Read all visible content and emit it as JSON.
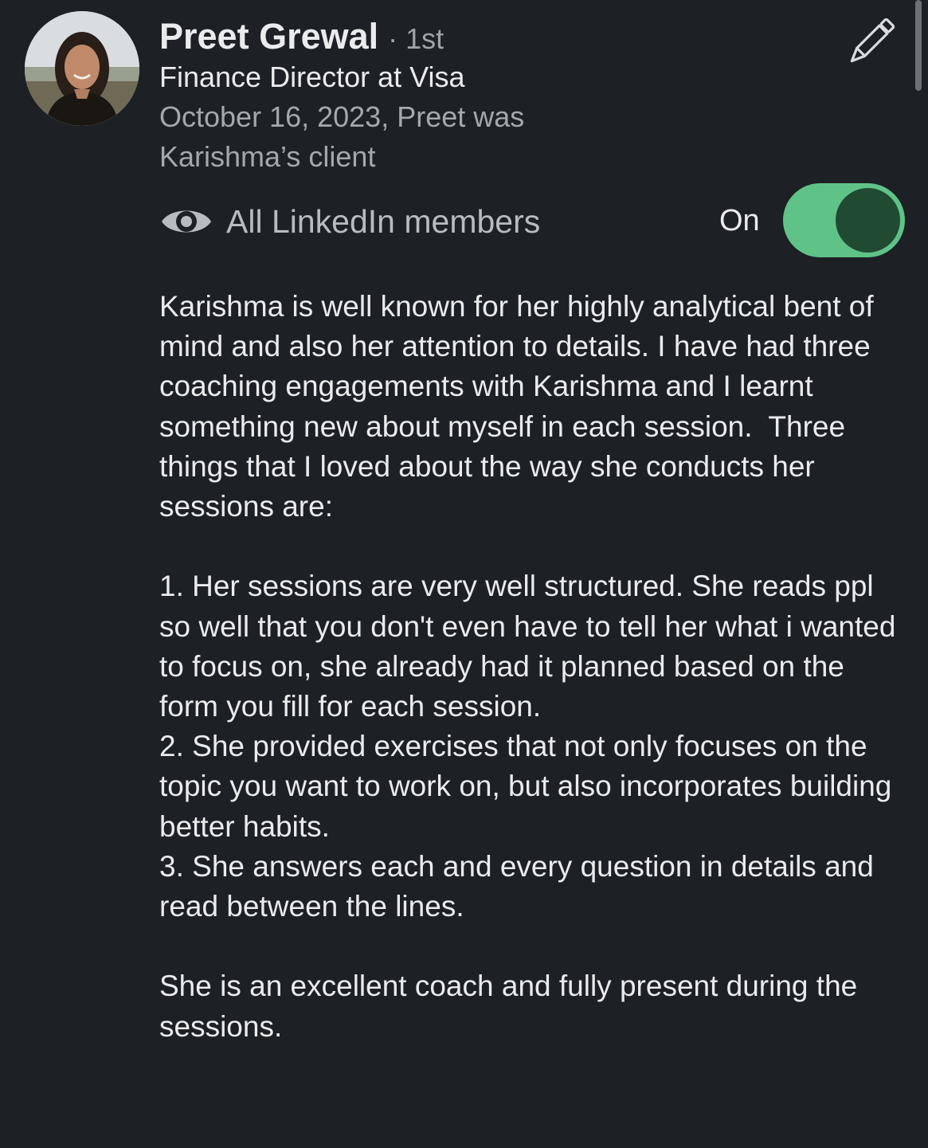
{
  "recommender": {
    "name": "Preet Grewal",
    "degree": "· 1st",
    "headline": "Finance Director at Visa",
    "relationship": "October 16, 2023, Preet was Karishma’s client"
  },
  "visibility": {
    "label": "All LinkedIn members",
    "toggle_state": "On",
    "toggle_on": true,
    "accent_color": "#5fc287"
  },
  "icons": {
    "edit": "pencil-icon",
    "visibility": "eye-icon"
  },
  "recommendation": {
    "text": "Karishma is well known for her highly analytical bent of mind and also her attention to details. I have had three coaching engagements with Karishma and I learnt something new about myself in each session.  Three things that I loved about the way she conducts her sessions are:\n\n1. Her sessions are very well structured. She reads ppl so well that you don't even have to tell her what i wanted to focus on, she already had it planned based on the form you fill for each session.\n2. She provided exercises that not only focuses on the topic you want to work on, but also incorporates building better habits.\n3. She answers each and every question in details and read between the lines.\n\nShe is an excellent coach and fully present during the sessions."
  }
}
